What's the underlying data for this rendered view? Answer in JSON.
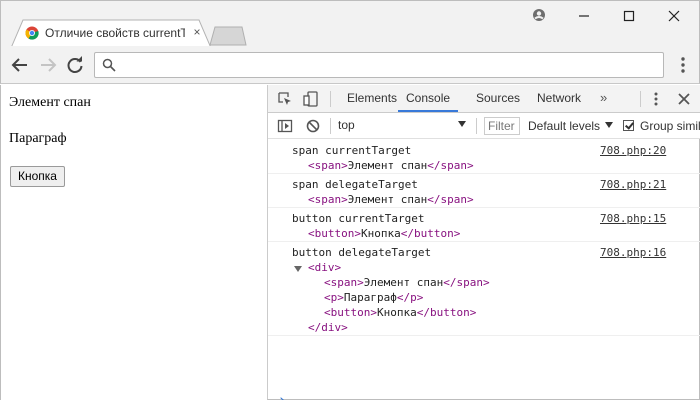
{
  "browser": {
    "tab_title": "Отличие свойств currentTarget",
    "tab_close": "×",
    "omnibox_value": ""
  },
  "page": {
    "span_text": "Элемент спан",
    "paragraph_text": "Параграф",
    "button_label": "Кнопка"
  },
  "devtools": {
    "tabs": [
      "Elements",
      "Console",
      "Sources",
      "Network"
    ],
    "active_tab": "Console",
    "more_tabs": "»",
    "context": "top",
    "filter_placeholder": "Filter",
    "levels": "Default levels",
    "group_similar": "Group similar",
    "group_similar_checked": true
  },
  "console": {
    "messages": [
      {
        "text": "span currentTarget",
        "source": "708.php:20",
        "element": [
          {
            "open": "<span>",
            "text": "Элемент спан",
            "close": "</span>"
          }
        ]
      },
      {
        "text": "span delegateTarget",
        "source": "708.php:21",
        "element": [
          {
            "open": "<span>",
            "text": "Элемент спан",
            "close": "</span>"
          }
        ]
      },
      {
        "text": "button currentTarget",
        "source": "708.php:15",
        "element": [
          {
            "open": "<button>",
            "text": "Кнопка",
            "close": "</button>"
          }
        ]
      },
      {
        "text": "button delegateTarget",
        "source": "708.php:16",
        "element": [
          {
            "open": "<div>",
            "text": "",
            "close": ""
          },
          {
            "open": "<span>",
            "text": "Элемент спан",
            "close": "</span>"
          },
          {
            "open": "<p>",
            "text": "Параграф",
            "close": "</p>"
          },
          {
            "open": "<button>",
            "text": "Кнопка",
            "close": "</button>"
          },
          {
            "open": "",
            "text": "",
            "close": "</div>"
          }
        ]
      }
    ],
    "prompt": "›"
  },
  "colors": {
    "tag": "#881280",
    "active_tab_underline": "#3879d9",
    "prompt": "#3a7bd5"
  }
}
